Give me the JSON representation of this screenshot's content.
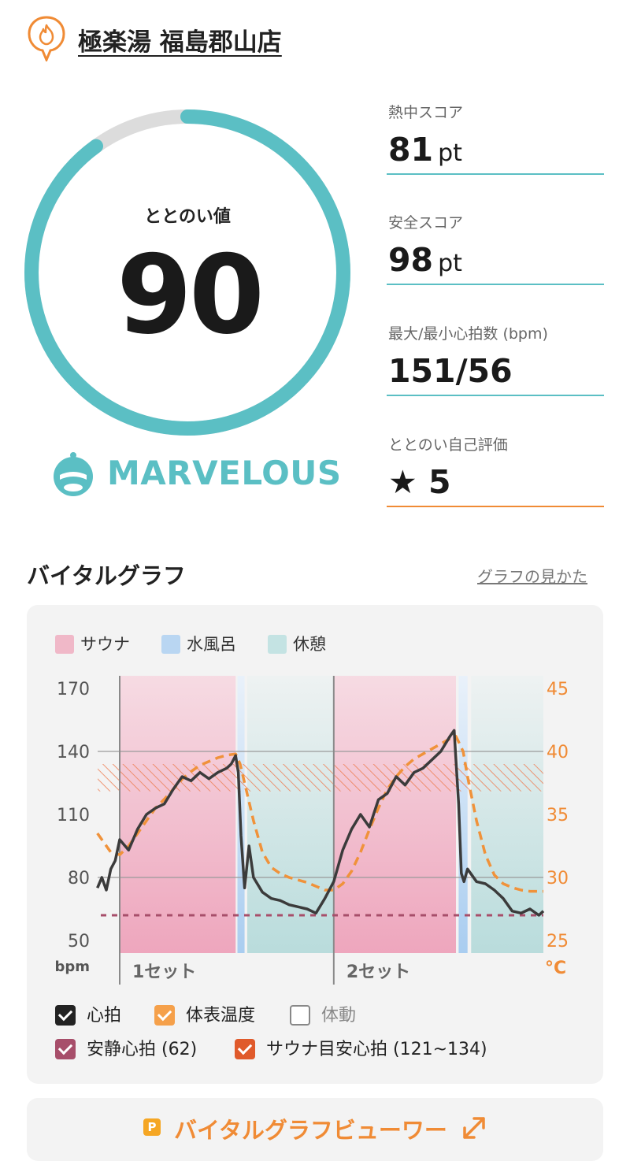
{
  "header": {
    "venue_name": "極楽湯 福島郡山店"
  },
  "score": {
    "label": "ととのい値",
    "value": "90",
    "progress": 0.9,
    "rank": "MARVELOUS"
  },
  "stats": [
    {
      "label": "熱中スコア",
      "value": "81",
      "unit": "pt"
    },
    {
      "label": "安全スコア",
      "value": "98",
      "unit": "pt"
    },
    {
      "label": "最大/最小心拍数 (bpm)",
      "value": "151/56",
      "unit": ""
    },
    {
      "label": "ととのい自己評価",
      "value": "★ 5",
      "unit": ""
    }
  ],
  "graph": {
    "title": "バイタルグラフ",
    "help_link": "グラフの見かた",
    "legend": [
      {
        "label": "サウナ",
        "color": "#f0b8c8"
      },
      {
        "label": "水風呂",
        "color": "#b9d6f2"
      },
      {
        "label": "休憩",
        "color": "#c4e3e3"
      }
    ],
    "toggles": [
      {
        "label": "心拍",
        "checked": true,
        "color": "#222222"
      },
      {
        "label": "体表温度",
        "checked": true,
        "color": "#f5a04a"
      },
      {
        "label": "体動",
        "checked": false,
        "color": "#888888"
      },
      {
        "label": "安静心拍 (62)",
        "checked": true,
        "color": "#a74e6a"
      },
      {
        "label": "サウナ目安心拍 (121~134)",
        "checked": true,
        "color": "#e05a2b"
      }
    ]
  },
  "chart_data": {
    "type": "line",
    "left_axis": {
      "label": "bpm",
      "ticks": [
        "170",
        "140",
        "110",
        "80",
        "50"
      ],
      "ylim": [
        50,
        170
      ]
    },
    "right_axis": {
      "label": "°C",
      "ticks": [
        "45",
        "40",
        "35",
        "30",
        "25"
      ],
      "ylim": [
        25,
        45
      ]
    },
    "x_segments": [
      "1セット",
      "2セット"
    ],
    "phases": [
      {
        "type": "サウナ",
        "start": 0,
        "end": 13
      },
      {
        "type": "水風呂",
        "start": 13.2,
        "end": 14
      },
      {
        "type": "休憩",
        "start": 14.3,
        "end": 24
      },
      {
        "type": "サウナ",
        "start": 24,
        "end": 37.7
      },
      {
        "type": "水風呂",
        "start": 38,
        "end": 39
      },
      {
        "type": "休憩",
        "start": 39.4,
        "end": 47.5
      }
    ],
    "resting_heart_rate": 62,
    "sauna_target_range": [
      121,
      134
    ],
    "series": [
      {
        "name": "心拍",
        "x": [
          -2.5,
          -2,
          -1.5,
          -1,
          -0.5,
          0,
          1,
          2,
          3,
          4,
          5,
          6,
          7,
          8,
          9,
          10,
          11,
          12,
          12.5,
          13,
          13.3,
          13.6,
          14,
          14.5,
          15,
          16,
          17,
          18,
          19,
          20,
          21,
          22,
          23,
          24,
          25,
          26,
          27,
          28,
          29,
          30,
          31,
          32,
          33,
          34,
          35,
          36,
          37,
          37.5,
          38,
          38.3,
          38.6,
          39,
          40,
          41,
          42,
          43,
          44,
          45,
          46,
          47,
          47.5
        ],
        "y": [
          75,
          80,
          74,
          84,
          88,
          98,
          93,
          103,
          110,
          113,
          115,
          122,
          128,
          126,
          130,
          127,
          130,
          132,
          134,
          138,
          130,
          100,
          75,
          95,
          80,
          73,
          70,
          69,
          67,
          66,
          65,
          63,
          70,
          78,
          93,
          103,
          110,
          104,
          117,
          120,
          128,
          124,
          130,
          132,
          136,
          140,
          147,
          150,
          115,
          82,
          78,
          84,
          78,
          77,
          74,
          70,
          64,
          63,
          65,
          62,
          64
        ]
      },
      {
        "name": "体表温度",
        "x": [
          -2.5,
          -1,
          0,
          1,
          2,
          3,
          4,
          5,
          6,
          7,
          8,
          9,
          10,
          11,
          12,
          13,
          13.5,
          14,
          15,
          16,
          17,
          18,
          19,
          20,
          21,
          22,
          23,
          24,
          25,
          26,
          27,
          28,
          29,
          30,
          31,
          32,
          33,
          34,
          35,
          36,
          37,
          37.7,
          38.5,
          39,
          40,
          41,
          42,
          43,
          44,
          45,
          46,
          47,
          47.5
        ],
        "y": [
          33.5,
          32,
          31.8,
          32.5,
          33.5,
          34.5,
          35.5,
          36.2,
          37,
          37.8,
          38.4,
          38.9,
          39.2,
          39.5,
          39.7,
          39.8,
          39,
          37.5,
          34.5,
          32,
          30.8,
          30.3,
          30,
          29.8,
          29.6,
          29.3,
          29,
          29,
          29.5,
          30.5,
          32,
          33.8,
          35.5,
          37,
          38,
          38.8,
          39.4,
          39.8,
          40.2,
          40.6,
          41,
          41.2,
          40,
          38,
          34.5,
          31.8,
          30.2,
          29.5,
          29.2,
          29,
          28.9,
          28.9,
          28.9
        ]
      }
    ]
  },
  "viewer": {
    "badge": "P",
    "label": "バイタルグラフビューワー"
  }
}
